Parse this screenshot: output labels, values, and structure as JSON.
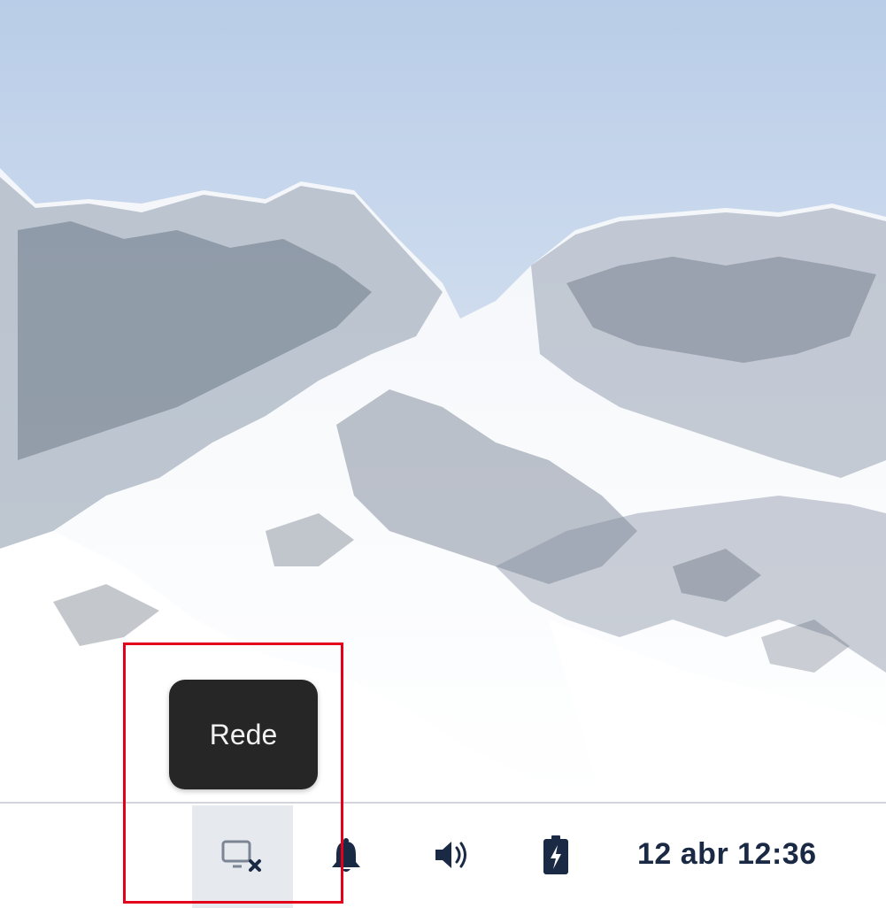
{
  "tooltip": {
    "text": "Rede"
  },
  "tray": {
    "network": {
      "icon": "network-disconnected-icon",
      "active": true
    },
    "notifications": {
      "icon": "bell-icon"
    },
    "volume": {
      "icon": "speaker-icon"
    },
    "battery": {
      "icon": "battery-charging-icon"
    }
  },
  "clock": {
    "text": "12 abr 12:36"
  },
  "colors": {
    "icon": "#1b2a44",
    "highlight": "#e3001b",
    "tooltip_bg": "#262626"
  }
}
